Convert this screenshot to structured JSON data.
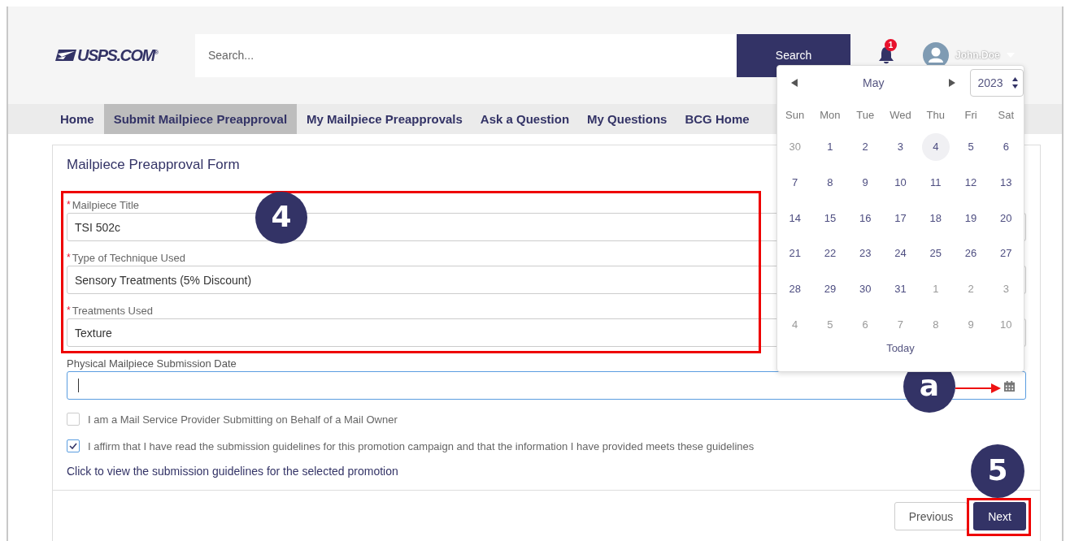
{
  "header": {
    "logo": "USPS.COM$^{®}$",
    "search": {
      "placeholder": "Search..."
    },
    "search_button": "Search",
    "notifications": {
      "count": "1"
    },
    "user": {
      "name": "John.Doe"
    }
  },
  "nav": [
    {
      "label": "Home",
      "selected": false
    },
    {
      "label": "Submit Mailpiece Preapproval",
      "selected": true
    },
    {
      "label": "My Mailpiece Preapprovals",
      "selected": false
    },
    {
      "label": "Ask a Question",
      "selected": false
    },
    {
      "label": "My Questions",
      "selected": false
    },
    {
      "label": "BCG Home",
      "selected": false
    }
  ],
  "form": {
    "title": "Mailpiece Preapproval Form",
    "required_mark": "*",
    "fields": [
      {
        "label": "Mailpiece Title",
        "required": true,
        "value": "TSI 502c",
        "focused": false
      },
      {
        "label": "Type of Technique Used",
        "required": true,
        "value": "Sensory Treatments (5% Discount)",
        "focused": false
      },
      {
        "label": "Treatments Used",
        "required": true,
        "value": "Texture",
        "focused": false
      }
    ],
    "date_field": {
      "label": "Physical Mailpiece Submission Date",
      "focused": true
    },
    "checkboxes": [
      {
        "label": "I am a Mail Service Provider Submitting on Behalf of a Mail Owner",
        "checked": false
      },
      {
        "label": "I affirm that I have read the submission guidelines for this promotion campaign and that the information I have provided meets these guidelines",
        "checked": true
      }
    ],
    "guidelines_link": "Click to view the submission guidelines for the selected promotion",
    "buttons": [
      {
        "label": "Previous",
        "kind": "secondary"
      },
      {
        "label": "Next",
        "kind": "primary"
      }
    ],
    "callouts": [
      {
        "kind": "group",
        "label": "4"
      },
      {
        "kind": "arrow",
        "label": "a"
      },
      {
        "kind": "button",
        "label": "5"
      }
    ]
  },
  "calendar": {
    "month": "May",
    "year": "2023",
    "weekdays": [
      "Sun",
      "Mon",
      "Tue",
      "Wed",
      "Thu",
      "Fri",
      "Sat"
    ],
    "days": [
      {
        "label": "30",
        "muted": true,
        "selected": false
      },
      {
        "label": "1",
        "muted": false,
        "selected": false
      },
      {
        "label": "2",
        "muted": false,
        "selected": false
      },
      {
        "label": "3",
        "muted": false,
        "selected": false
      },
      {
        "label": "4",
        "muted": false,
        "selected": true
      },
      {
        "label": "5",
        "muted": false,
        "selected": false
      },
      {
        "label": "6",
        "muted": false,
        "selected": false
      },
      {
        "label": "7",
        "muted": false,
        "selected": false
      },
      {
        "label": "8",
        "muted": false,
        "selected": false
      },
      {
        "label": "9",
        "muted": false,
        "selected": false
      },
      {
        "label": "10",
        "muted": false,
        "selected": false
      },
      {
        "label": "11",
        "muted": false,
        "selected": false
      },
      {
        "label": "12",
        "muted": false,
        "selected": false
      },
      {
        "label": "13",
        "muted": false,
        "selected": false
      },
      {
        "label": "14",
        "muted": false,
        "selected": false
      },
      {
        "label": "15",
        "muted": false,
        "selected": false
      },
      {
        "label": "16",
        "muted": false,
        "selected": false
      },
      {
        "label": "17",
        "muted": false,
        "selected": false
      },
      {
        "label": "18",
        "muted": false,
        "selected": false
      },
      {
        "label": "19",
        "muted": false,
        "selected": false
      },
      {
        "label": "20",
        "muted": false,
        "selected": false
      },
      {
        "label": "21",
        "muted": false,
        "selected": false
      },
      {
        "label": "22",
        "muted": false,
        "selected": false
      },
      {
        "label": "23",
        "muted": false,
        "selected": false
      },
      {
        "label": "24",
        "muted": false,
        "selected": false
      },
      {
        "label": "25",
        "muted": false,
        "selected": false
      },
      {
        "label": "26",
        "muted": false,
        "selected": false
      },
      {
        "label": "27",
        "muted": false,
        "selected": false
      },
      {
        "label": "28",
        "muted": false,
        "selected": false
      },
      {
        "label": "29",
        "muted": false,
        "selected": false
      },
      {
        "label": "30",
        "muted": false,
        "selected": false
      },
      {
        "label": "31",
        "muted": false,
        "selected": false
      },
      {
        "label": "1",
        "muted": true,
        "selected": false
      },
      {
        "label": "2",
        "muted": true,
        "selected": false
      },
      {
        "label": "3",
        "muted": true,
        "selected": false
      },
      {
        "label": "4",
        "muted": true,
        "selected": false
      },
      {
        "label": "5",
        "muted": true,
        "selected": false
      },
      {
        "label": "6",
        "muted": true,
        "selected": false
      },
      {
        "label": "7",
        "muted": true,
        "selected": false
      },
      {
        "label": "8",
        "muted": true,
        "selected": false
      },
      {
        "label": "9",
        "muted": true,
        "selected": false
      },
      {
        "label": "10",
        "muted": true,
        "selected": false
      }
    ],
    "today_button": "Today"
  }
}
